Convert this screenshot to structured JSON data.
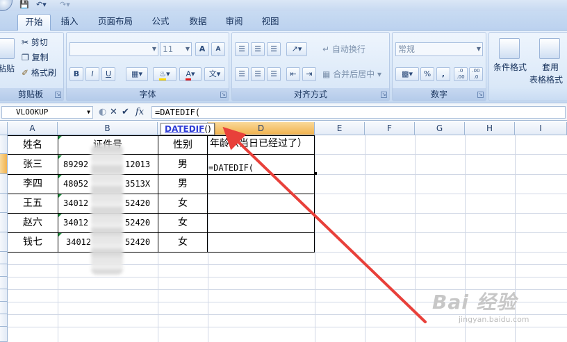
{
  "ribbon": {
    "tabs": [
      "开始",
      "插入",
      "页面布局",
      "公式",
      "数据",
      "审阅",
      "视图"
    ],
    "active_tab": "开始",
    "clipboard": {
      "paste": "粘贴",
      "cut": "剪切",
      "copy": "复制",
      "format_painter": "格式刷",
      "label": "剪贴板"
    },
    "font": {
      "font_name": "",
      "font_size": "11",
      "grow": "A",
      "shrink": "A",
      "bold": "B",
      "italic": "I",
      "underline": "U",
      "font_color": "A",
      "phonetic": "文",
      "label": "字体"
    },
    "alignment": {
      "wrap_text": "自动换行",
      "merge_center": "合并后居中",
      "label": "对齐方式"
    },
    "number": {
      "format": "常规",
      "percent": "%",
      "comma": ",",
      "inc_decimal": ".0 .00",
      "dec_decimal": ".00 .0",
      "label": "数字"
    },
    "styles": {
      "conditional_formatting_a": "条件格式",
      "table_format_a": "套用",
      "table_format_b": "表格格式"
    }
  },
  "formula_bar": {
    "name_box": "VLOOKUP",
    "fx": "fx",
    "formula": "=DATEDIF("
  },
  "grid": {
    "columns": [
      "A",
      "B",
      "C",
      "D",
      "E",
      "F",
      "G",
      "H",
      "I"
    ],
    "selected_column": "D",
    "tooltip_func": "DATEDIF",
    "tooltip_rest": "()",
    "header_row": {
      "a": "姓名",
      "b": "证件号",
      "c": "性别",
      "d": "年龄（当日已经过了）"
    },
    "rows": [
      {
        "name": "张三",
        "id_left": "89292",
        "id_right": "12013",
        "gender": "男",
        "age": "=DATEDIF("
      },
      {
        "name": "李四",
        "id_left": "48052",
        "id_right": "3513X",
        "gender": "男",
        "age": ""
      },
      {
        "name": "王五",
        "id_left": "34012",
        "id_right": "52420",
        "gender": "女",
        "age": ""
      },
      {
        "name": "赵六",
        "id_left": "34012",
        "id_right": "52420",
        "gender": "女",
        "age": ""
      },
      {
        "name": "钱七",
        "id_left": "34012",
        "id_right": "52420",
        "gender": "女",
        "age": ""
      }
    ]
  },
  "watermark": {
    "brand": "Bai 经验",
    "url": "jingyan.baidu.com"
  },
  "colors": {
    "arrow": "#e8403a",
    "selected_header": "#f1b24e",
    "tab_bg": "#bcd2ef"
  }
}
